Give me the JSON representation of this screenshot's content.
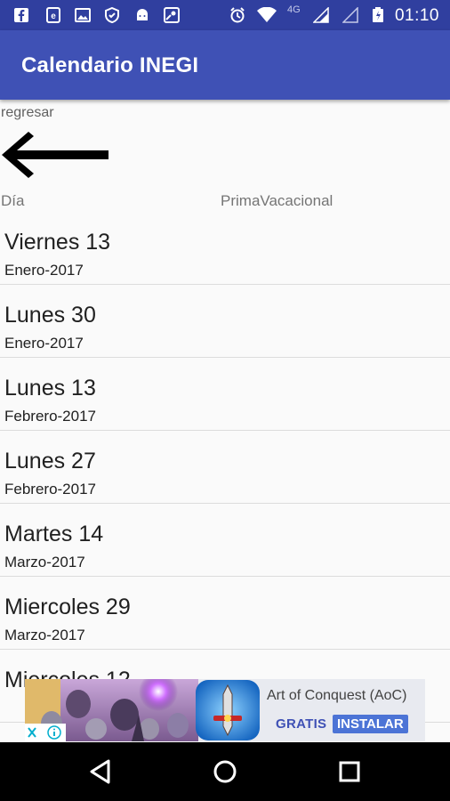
{
  "status_bar": {
    "time": "01:10",
    "network": "4G",
    "icons": [
      "facebook-icon",
      "ebay-icon",
      "image-icon",
      "shield-icon",
      "android-icon",
      "maps-icon",
      "alarm-icon",
      "wifi-icon",
      "signal-icon",
      "signal-empty-icon",
      "battery-icon"
    ]
  },
  "app_bar": {
    "title": "Calendario INEGI"
  },
  "back": {
    "label": "regresar"
  },
  "headers": {
    "dia": "Día",
    "prima": "PrimaVacacional"
  },
  "items": [
    {
      "day": "Viernes 13",
      "month": "Enero-2017"
    },
    {
      "day": "Lunes 30",
      "month": "Enero-2017"
    },
    {
      "day": "Lunes 13",
      "month": "Febrero-2017"
    },
    {
      "day": "Lunes 27",
      "month": "Febrero-2017"
    },
    {
      "day": "Martes 14",
      "month": "Marzo-2017"
    },
    {
      "day": "Miercoles 29",
      "month": "Marzo-2017"
    },
    {
      "day": "Miercoles 12",
      "month": ""
    }
  ],
  "ad": {
    "title": "Art of Conquest (AoC)",
    "gratis": "GRATIS",
    "install": "INSTALAR"
  },
  "nav": [
    "back-icon",
    "home-icon",
    "recents-icon"
  ],
  "colors": {
    "status_bar": "#303f9f",
    "app_bar": "#3f51b5",
    "install_button": "#4c74d6"
  }
}
